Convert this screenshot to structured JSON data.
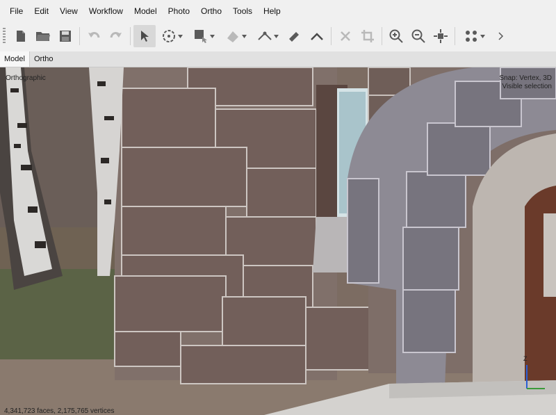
{
  "menu": [
    "File",
    "Edit",
    "View",
    "Workflow",
    "Model",
    "Photo",
    "Ortho",
    "Tools",
    "Help"
  ],
  "tabs": [
    "Model",
    "Ortho"
  ],
  "viewport": {
    "projection": "Orthographic",
    "snap": "Snap: Vertex, 3D",
    "selection": "Visible selection",
    "stats": "4,341,723 faces, 2,175,765 vertices",
    "axis_label": "Z"
  },
  "colors": {
    "accent": "#2a5fd6",
    "icon": "#5a5a5a",
    "icon_disabled": "#b9b9b9"
  }
}
